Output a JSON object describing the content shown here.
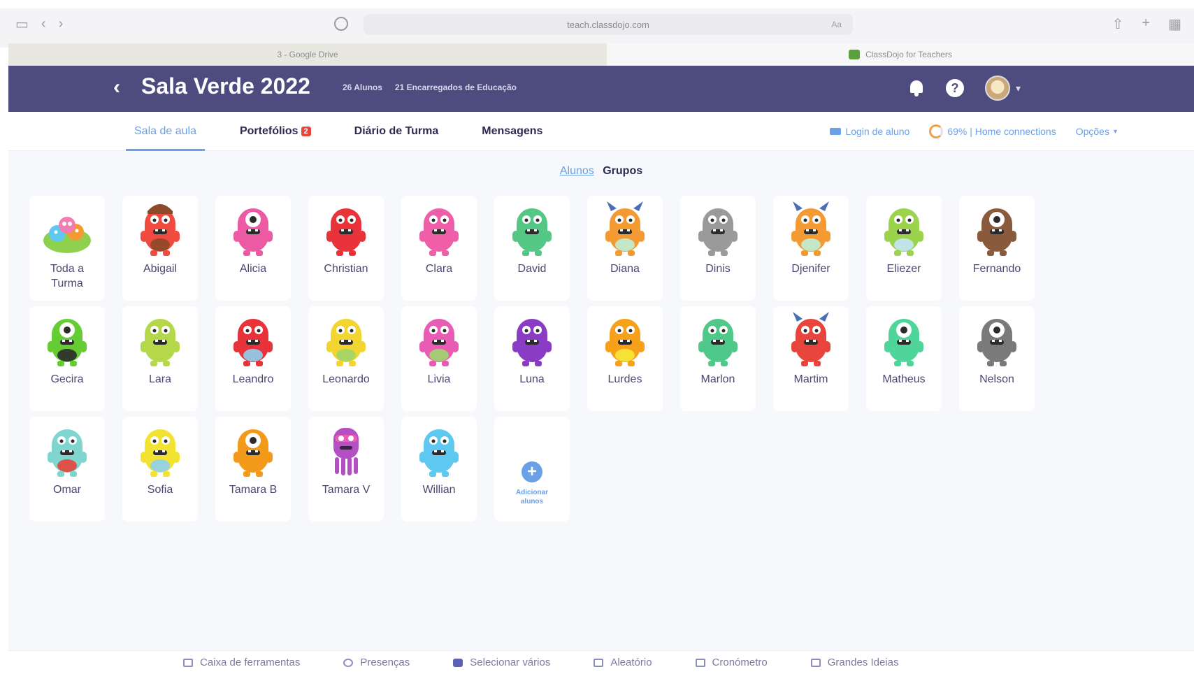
{
  "browser": {
    "url": "teach.classdojo.com",
    "url_right": "Aa",
    "tabs": [
      {
        "label": "3 - Google Drive"
      },
      {
        "label": "ClassDojo for Teachers"
      }
    ]
  },
  "header": {
    "back": "‹",
    "class_name": "Sala Verde 2022",
    "students_count": "26 Alunos",
    "guardians_count": "21 Encarregados de Educação",
    "help": "?",
    "avatar_caret": "▾"
  },
  "nav": {
    "tabs": [
      {
        "label": "Sala de aula",
        "active": true
      },
      {
        "label": "Portefólios",
        "badge": "2"
      },
      {
        "label": "Diário de Turma"
      },
      {
        "label": "Mensagens"
      }
    ],
    "login": "Login de aluno",
    "connection": "69% | Home connections",
    "options": "Opções",
    "options_caret": "▾"
  },
  "view_toggle": {
    "students": "Alunos",
    "groups": "Grupos"
  },
  "colors": {
    "header_bg": "#4e4b7e",
    "accent": "#6aa0e6",
    "badge": "#e8453c"
  },
  "students": [
    {
      "name": "Toda a Turma",
      "color": "#8fd14f",
      "accent": "#f27db0",
      "type": "group"
    },
    {
      "name": "Abigail",
      "color": "#ef4b3f",
      "accent": "#8b4a2a",
      "type": "hair"
    },
    {
      "name": "Alicia",
      "color": "#ec5aa4",
      "accent": "#ffffff",
      "type": "cyclops"
    },
    {
      "name": "Christian",
      "color": "#e8333b",
      "accent": "#ffffff",
      "type": "blob"
    },
    {
      "name": "Clara",
      "color": "#ef5fa9",
      "accent": "#ffffff",
      "type": "blob"
    },
    {
      "name": "David",
      "color": "#54c785",
      "accent": "#ffffff",
      "type": "blob"
    },
    {
      "name": "Diana",
      "color": "#f39a33",
      "accent": "#bff0d8",
      "type": "horns"
    },
    {
      "name": "Dinis",
      "color": "#9a9a9a",
      "accent": "#ffffff",
      "type": "blob"
    },
    {
      "name": "Djenifer",
      "color": "#f49a33",
      "accent": "#bff0d8",
      "type": "horns"
    },
    {
      "name": "Eliezer",
      "color": "#9bd34c",
      "accent": "#c6e6f7",
      "type": "blob"
    },
    {
      "name": "Fernando",
      "color": "#8a5a3c",
      "accent": "#ffffff",
      "type": "cyclops"
    },
    {
      "name": "Gecira",
      "color": "#66cc33",
      "accent": "#2b2b2b",
      "type": "cyclops"
    },
    {
      "name": "Lara",
      "color": "#b5d84a",
      "accent": "#ffffff",
      "type": "blob"
    },
    {
      "name": "Leandro",
      "color": "#e8333b",
      "accent": "#8ed0f0",
      "type": "blob"
    },
    {
      "name": "Leonardo",
      "color": "#f2d530",
      "accent": "#9fd66b",
      "type": "blob"
    },
    {
      "name": "Livia",
      "color": "#e85cb3",
      "accent": "#9fd66b",
      "type": "blob"
    },
    {
      "name": "Luna",
      "color": "#8a3dc4",
      "accent": "#ffffff",
      "type": "blob"
    },
    {
      "name": "Lurdes",
      "color": "#f7a11a",
      "accent": "#f7e83a",
      "type": "blob"
    },
    {
      "name": "Marlon",
      "color": "#4fc98a",
      "accent": "#ffffff",
      "type": "blob"
    },
    {
      "name": "Martim",
      "color": "#e8453c",
      "accent": "#ffffff",
      "type": "horns"
    },
    {
      "name": "Matheus",
      "color": "#4fd49a",
      "accent": "#ffffff",
      "type": "cyclops"
    },
    {
      "name": "Nelson",
      "color": "#7a7a7a",
      "accent": "#ffffff",
      "type": "cyclops"
    },
    {
      "name": "Omar",
      "color": "#7fd6cf",
      "accent": "#e8453c",
      "type": "blob"
    },
    {
      "name": "Sofia",
      "color": "#f2e333",
      "accent": "#8ed0f0",
      "type": "blob"
    },
    {
      "name": "Tamara B",
      "color": "#f39a1a",
      "accent": "#ffffff",
      "type": "cyclops"
    },
    {
      "name": "Tamara V",
      "color": "#b54fc4",
      "accent": "#ffffff",
      "type": "squid"
    },
    {
      "name": "Willian",
      "color": "#5fc8f0",
      "accent": "#ffffff",
      "type": "blob"
    }
  ],
  "add_student": {
    "icon": "+",
    "label": "Adicionar alunos"
  },
  "toolbar": [
    {
      "label": "Caixa de ferramentas",
      "icon": "toolbox-icon"
    },
    {
      "label": "Presenças",
      "icon": "attendance-icon"
    },
    {
      "label": "Selecionar vários",
      "icon": "select-multiple-icon"
    },
    {
      "label": "Aleatório",
      "icon": "random-icon"
    },
    {
      "label": "Cronómetro",
      "icon": "timer-icon"
    },
    {
      "label": "Grandes Ideias",
      "icon": "big-ideas-icon"
    }
  ]
}
